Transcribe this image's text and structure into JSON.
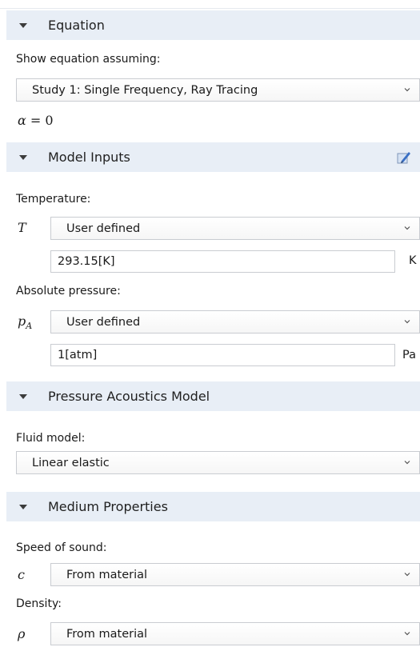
{
  "equation": {
    "header": "Equation",
    "show_label": "Show equation assuming:",
    "study_select": "Study 1: Single Frequency, Ray Tracing",
    "formula_var": "α",
    "formula_rest": " = 0"
  },
  "model_inputs": {
    "header": "Model Inputs",
    "temperature": {
      "label": "Temperature:",
      "symbol": "T",
      "select": "User defined",
      "value": "293.15[K]",
      "unit": "K"
    },
    "pressure": {
      "label": "Absolute pressure:",
      "symbol": "p",
      "symbol_sub": "A",
      "select": "User defined",
      "value": "1[atm]",
      "unit": "Pa"
    }
  },
  "pressure_acoustics": {
    "header": "Pressure Acoustics Model",
    "fluid_label": "Fluid model:",
    "fluid_select": "Linear elastic"
  },
  "medium": {
    "header": "Medium Properties",
    "speed": {
      "label": "Speed of sound:",
      "symbol": "c",
      "select": "From material"
    },
    "density": {
      "label": "Density:",
      "symbol": "ρ",
      "select": "From material"
    }
  },
  "icons": {
    "caret": "caret-down-icon",
    "chevron": "chevron-down-icon",
    "edit": "edit-pencil-icon"
  },
  "colors": {
    "header_bg": "#e8eef6",
    "border": "#c9ccd1",
    "edit_icon": "#3a6fc4"
  }
}
